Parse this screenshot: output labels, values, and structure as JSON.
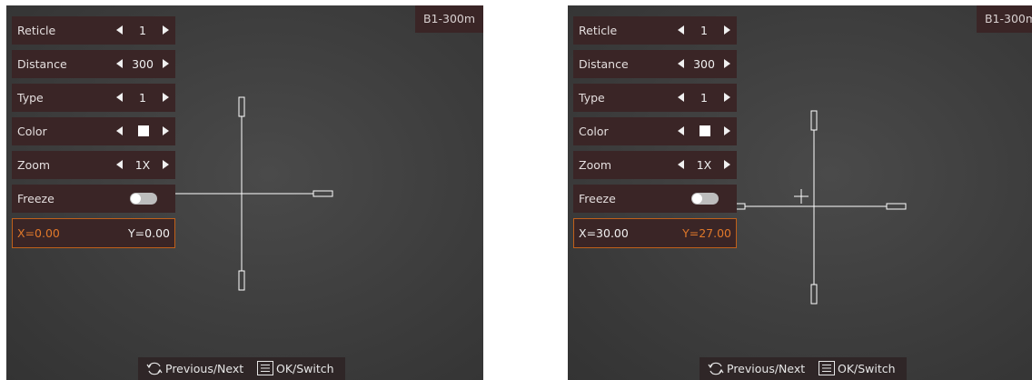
{
  "panels": [
    {
      "badge": "B1-300m",
      "menu": [
        {
          "label": "Reticle",
          "value": "1"
        },
        {
          "label": "Distance",
          "value": "300"
        },
        {
          "label": "Type",
          "value": "1"
        },
        {
          "label": "Color",
          "value": ""
        },
        {
          "label": "Zoom",
          "value": "1X"
        },
        {
          "label": "Freeze",
          "value": ""
        }
      ],
      "coords": {
        "x": "X=0.00",
        "y": "Y=0.00",
        "active": "x"
      },
      "footer": {
        "prev_next": "Previous/Next",
        "ok_switch": "OK/Switch"
      }
    },
    {
      "badge": "B1-300m",
      "menu": [
        {
          "label": "Reticle",
          "value": "1"
        },
        {
          "label": "Distance",
          "value": "300"
        },
        {
          "label": "Type",
          "value": "1"
        },
        {
          "label": "Color",
          "value": ""
        },
        {
          "label": "Zoom",
          "value": "1X"
        },
        {
          "label": "Freeze",
          "value": ""
        }
      ],
      "coords": {
        "x": "X=30.00",
        "y": "Y=27.00",
        "active": "y"
      },
      "footer": {
        "prev_next": "Previous/Next",
        "ok_switch": "OK/Switch"
      }
    }
  ],
  "colors": {
    "menu_bg": "#3a2526",
    "highlight": "#e0782a",
    "reticle": "#ffffff",
    "swatch": "#ffffff"
  },
  "icons": [
    "rotate-icon",
    "menu-list-icon",
    "arrow-left-icon",
    "arrow-right-icon"
  ]
}
